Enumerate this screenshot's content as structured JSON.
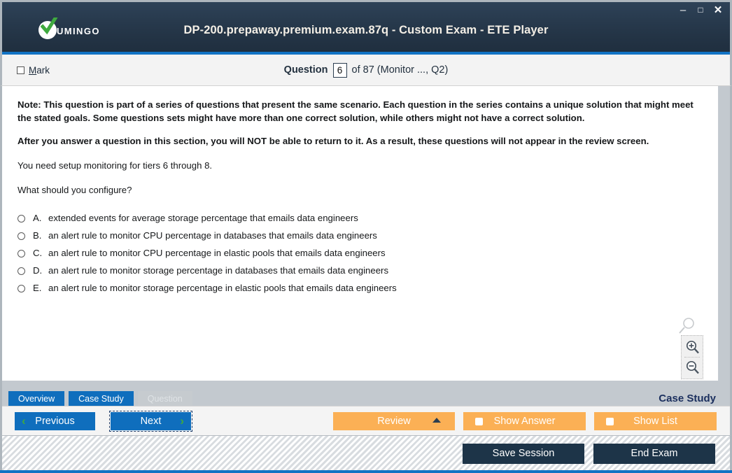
{
  "window": {
    "title": "DP-200.prepaway.premium.exam.87q - Custom Exam - ETE Player",
    "logo_text": "UMINGO",
    "controls": {
      "minimize": "–",
      "maximize": "□",
      "close": "✕"
    }
  },
  "header": {
    "mark_label_prefix": "M",
    "mark_label_rest": "ark",
    "question_word": "Question",
    "question_number": "6",
    "of_text": "of 87 (Monitor ..., Q2)"
  },
  "question": {
    "note": "Note: This question is part of a series of questions that present the same scenario. Each question in the series contains a unique solution that might meet the stated goals. Some questions sets might have more than one correct solution, while others might not have a correct solution.",
    "warning": "After you answer a question in this section, you will NOT be able to return to it. As a result, these questions will not appear in the review screen.",
    "scenario": "You need setup monitoring for tiers 6 through 8.",
    "prompt": "What should you configure?",
    "options": [
      {
        "letter": "A.",
        "text": "extended events for average storage percentage that emails data engineers"
      },
      {
        "letter": "B.",
        "text": "an alert rule to monitor CPU percentage in databases that emails data engineers"
      },
      {
        "letter": "C.",
        "text": "an alert rule to monitor CPU percentage in elastic pools that emails data engineers"
      },
      {
        "letter": "D.",
        "text": "an alert rule to monitor storage percentage in databases that emails data engineers"
      },
      {
        "letter": "E.",
        "text": "an alert rule to monitor storage percentage in elastic pools that emails data engineers"
      }
    ]
  },
  "tabs": [
    {
      "label": "Overview",
      "state": "enabled"
    },
    {
      "label": "Case Study",
      "state": "enabled"
    },
    {
      "label": "Question",
      "state": "disabled"
    }
  ],
  "section_label": "Case Study",
  "nav": {
    "previous": "Previous",
    "next": "Next",
    "prev_chevron": "‹",
    "next_chevron": "›"
  },
  "actions": {
    "review": "Review",
    "show_answer": "Show Answer",
    "show_list": "Show List"
  },
  "footer": {
    "save_session": "Save Session",
    "end_exam": "End Exam"
  },
  "colors": {
    "accent_blue": "#0f6ebd",
    "titlebar_dark": "#223243",
    "orange": "#fbb055",
    "footer_button": "#1d3448",
    "check_green": "#3faa3f"
  }
}
